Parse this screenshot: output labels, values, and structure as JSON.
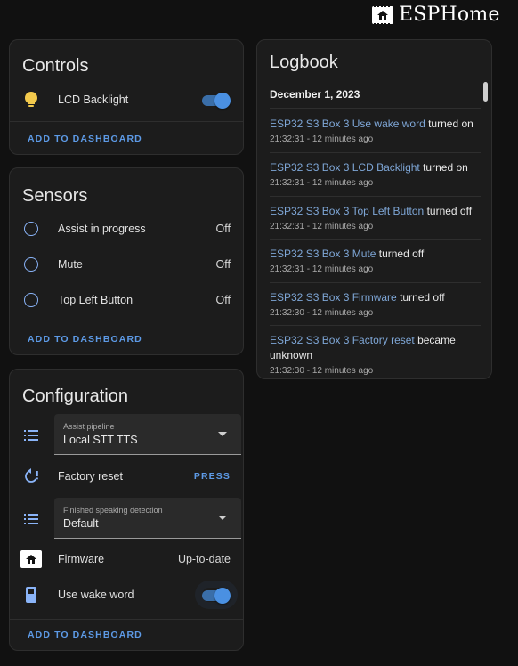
{
  "brand": {
    "name": "ESPHome",
    "icon": "esphome-chip-icon"
  },
  "controls": {
    "title": "Controls",
    "items": [
      {
        "label": "LCD Backlight",
        "icon": "lightbulb-icon",
        "state": "on"
      }
    ],
    "action": "ADD TO DASHBOARD"
  },
  "sensors": {
    "title": "Sensors",
    "items": [
      {
        "label": "Assist in progress",
        "value": "Off",
        "icon": "circle-outline-icon"
      },
      {
        "label": "Mute",
        "value": "Off",
        "icon": "circle-outline-icon"
      },
      {
        "label": "Top Left Button",
        "value": "Off",
        "icon": "circle-outline-icon"
      }
    ],
    "action": "ADD TO DASHBOARD"
  },
  "configuration": {
    "title": "Configuration",
    "assist_pipeline": {
      "label": "Assist pipeline",
      "value": "Local STT TTS",
      "icon": "format-list-bulleted-icon"
    },
    "factory_reset": {
      "label": "Factory reset",
      "button": "PRESS",
      "icon": "restart-alert-icon"
    },
    "finished_speaking": {
      "label": "Finished speaking detection",
      "value": "Default",
      "icon": "format-list-bulleted-icon"
    },
    "firmware": {
      "label": "Firmware",
      "value": "Up-to-date",
      "icon": "esphome-chip-icon"
    },
    "wake_word": {
      "label": "Use wake word",
      "icon": "cellphone-icon",
      "state": "on"
    },
    "action": "ADD TO DASHBOARD"
  },
  "logbook": {
    "title": "Logbook",
    "date": "December 1, 2023",
    "entries": [
      {
        "entity": "ESP32 S3 Box 3 Use wake word",
        "message": " turned on",
        "time": "21:32:31 - 12 minutes ago"
      },
      {
        "entity": "ESP32 S3 Box 3 LCD Backlight",
        "message": " turned on",
        "time": "21:32:31 - 12 minutes ago"
      },
      {
        "entity": "ESP32 S3 Box 3 Top Left Button",
        "message": " turned off",
        "time": "21:32:31 - 12 minutes ago"
      },
      {
        "entity": "ESP32 S3 Box 3 Mute",
        "message": " turned off",
        "time": "21:32:31 - 12 minutes ago"
      },
      {
        "entity": "ESP32 S3 Box 3 Firmware",
        "message": " turned off",
        "time": "21:32:30 - 12 minutes ago"
      },
      {
        "entity": "ESP32 S3 Box 3 Factory reset",
        "message": " became unknown",
        "time": "21:32:30 - 12 minutes ago"
      }
    ]
  },
  "colors": {
    "accent": "#5d9ae6",
    "bulb": "#f2c94c",
    "background": "#111111",
    "card": "#1c1c1c"
  }
}
